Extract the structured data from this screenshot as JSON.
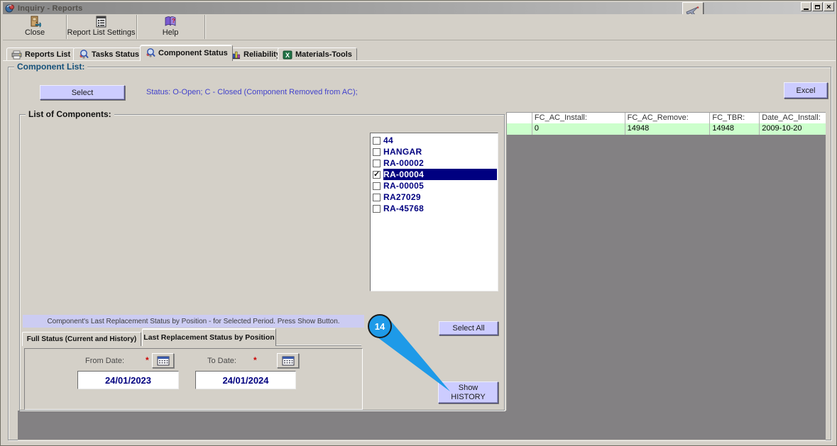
{
  "window": {
    "title": "Inquiry - Reports"
  },
  "toolbar": {
    "close": "Close",
    "report_list_settings": "Report List Settings",
    "help": "Help"
  },
  "tabs": {
    "items": [
      {
        "label": "Reports List"
      },
      {
        "label": "Tasks Status"
      },
      {
        "label": "Component Status"
      },
      {
        "label": "Reliability"
      },
      {
        "label": "Materials-Tools"
      }
    ],
    "active": "Component Status"
  },
  "component_list": {
    "label": "Component List:",
    "select_button": "Select",
    "status_text": "Status: O-Open; C - Closed (Component Removed from AC);",
    "excel_button": "Excel"
  },
  "results_grid": {
    "columns": [
      "",
      "FC_AC_Install:",
      "FC_AC_Remove:",
      "FC_TBR:",
      "Date_AC_Install:"
    ],
    "row": [
      "",
      "0",
      "14948",
      "14948",
      "2009-10-20"
    ]
  },
  "list_of_components": {
    "label": "List of Components:",
    "items": [
      {
        "label": "44",
        "checked": false,
        "selected": false
      },
      {
        "label": "HANGAR",
        "checked": false,
        "selected": false
      },
      {
        "label": "RA-00002",
        "checked": false,
        "selected": false
      },
      {
        "label": "RA-00004",
        "checked": true,
        "selected": true
      },
      {
        "label": "RA-00005",
        "checked": false,
        "selected": false
      },
      {
        "label": "RA27029",
        "checked": false,
        "selected": false
      },
      {
        "label": "RA-45768",
        "checked": false,
        "selected": false
      }
    ],
    "select_all_button": "Select All"
  },
  "replacement": {
    "message": "Component's Last Replacement Status by Position - for Selected Period. Press Show Button.",
    "tab_full": "Full Status (Current and History)",
    "tab_last": "Last Replacement Status by Position",
    "active_tab": "Last Replacement Status by Position",
    "from_label": "From Date:",
    "from_value": "24/01/2023",
    "to_label": "To Date:",
    "to_value": "24/01/2024",
    "required_marker": "*",
    "show_button_line1": "Show",
    "show_button_line2": "HISTORY"
  },
  "callout": {
    "number": "14",
    "color": "#1e9ae8"
  },
  "colors": {
    "button_accent": "#ccccff",
    "row_green": "#ccffcc",
    "selection_navy": "#000080",
    "grid_gray": "#838183",
    "status_blue": "#4242cc",
    "titlebar_gray": "#9a9a9a"
  }
}
